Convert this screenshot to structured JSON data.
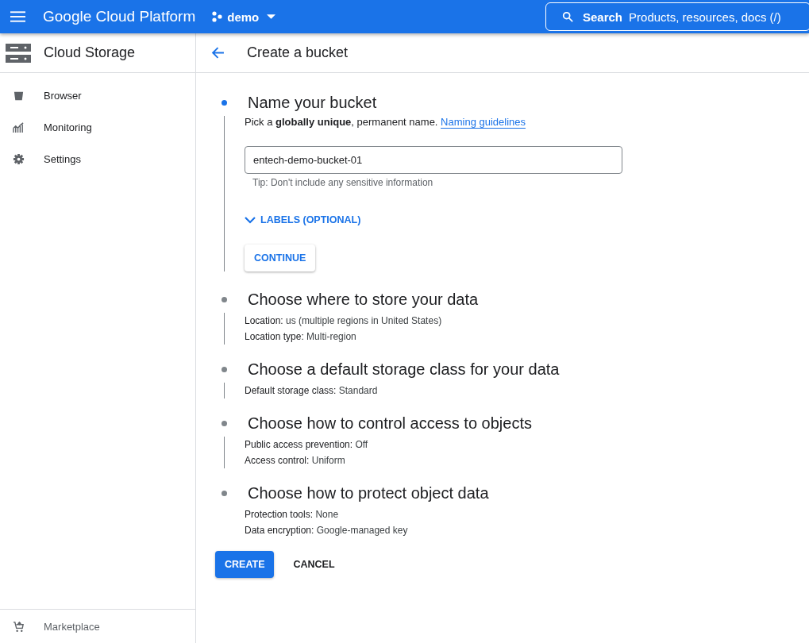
{
  "topbar": {
    "product": "Google Cloud Platform",
    "project": "demo",
    "search_label": "Search",
    "search_placeholder": "Products, resources, docs (/)"
  },
  "sidebar": {
    "title": "Cloud Storage",
    "items": [
      {
        "label": "Browser"
      },
      {
        "label": "Monitoring"
      },
      {
        "label": "Settings"
      }
    ],
    "footer_item": {
      "label": "Marketplace"
    }
  },
  "page": {
    "title": "Create a bucket"
  },
  "steps": [
    {
      "kind": "form",
      "title": "Name your bucket",
      "active": true,
      "description": "Pick a **globally unique**, permanent name.",
      "link": "Naming guidelines",
      "field_value": "entech-demo-bucket-01",
      "tip": "Tip: Don't include any sensitive information",
      "toggle": "LABELS (OPTIONAL)",
      "button": "CONTINUE"
    },
    {
      "kind": "summary",
      "title": "Choose where to store your data",
      "active": false,
      "details": [
        {
          "label": "Location:",
          "value": "us (multiple regions in United States)"
        },
        {
          "label": "Location type:",
          "value": "Multi-region"
        }
      ]
    },
    {
      "kind": "summary",
      "title": "Choose a default storage class for your data",
      "active": false,
      "details": [
        {
          "label": "Default storage class:",
          "value": "Standard"
        }
      ]
    },
    {
      "kind": "summary",
      "title": "Choose how to control access to objects",
      "active": false,
      "details": [
        {
          "label": "Public access prevention:",
          "value": "Off"
        },
        {
          "label": "Access control:",
          "value": "Uniform"
        }
      ]
    },
    {
      "kind": "summary",
      "title": "Choose how to protect object data",
      "active": false,
      "details": [
        {
          "label": "Protection tools:",
          "value": "None"
        },
        {
          "label": "Data encryption:",
          "value": "Google-managed key"
        }
      ]
    }
  ],
  "actions": {
    "primary": "CREATE",
    "secondary": "CANCEL"
  }
}
